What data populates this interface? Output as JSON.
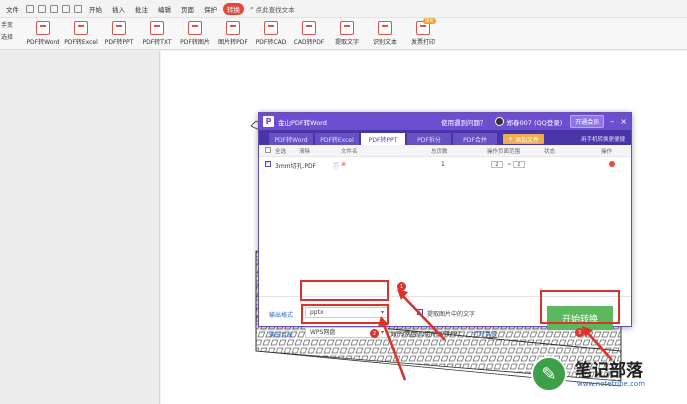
{
  "menubar": {
    "file": "文件",
    "items": [
      "开始",
      "插入",
      "批注",
      "编辑",
      "页面",
      "保护",
      "转换"
    ],
    "search": "点此查找文本"
  },
  "ribbon": {
    "side": [
      "手变",
      "选择"
    ],
    "buttons": [
      "PDF转Word",
      "PDF转Excel",
      "PDF转PPT",
      "PDF转TXT",
      "PDF转图片",
      "图片转PDF",
      "PDF转CAD",
      "CAD转PDF",
      "提取文字",
      "识别文本",
      "发票打印"
    ],
    "badge": "限免"
  },
  "dialog": {
    "title": "金山PDF转Word",
    "help": "使用遇到问题？",
    "user": "郑春007 (QQ登录)",
    "vip": "开通会员",
    "tabs": [
      "PDF转Word",
      "PDF转Excel",
      "PDF转PPT",
      "PDF拆分",
      "PDF合并"
    ],
    "active_tab": "PDF转PPT",
    "add_file": "添加文件",
    "mobile": "用手机转换更便捷",
    "headers": {
      "select_all": "全选",
      "clear": "清除",
      "filename": "文件名",
      "pages": "总页数",
      "range": "操作页面范围",
      "status": "状态",
      "action": "操作"
    },
    "row": {
      "filename": "3mm切孔.PDF",
      "pages": "1",
      "range_from": "1",
      "range_to": "1"
    },
    "output_format_label": "输出格式",
    "output_format_value": "pptx",
    "output_dir_label": "输出目录",
    "output_dir_value": "WPS网盘",
    "extract_text": "提取图片中的文字",
    "path_text": "WPS网盘/应用/PDF转PPT",
    "open_dir": "打开目录",
    "start": "开始转换"
  },
  "markers": [
    "1",
    "2",
    "3"
  ],
  "watermark": {
    "text": "笔记部落",
    "url": "www.notetribe.com"
  },
  "colors": {
    "accent": "#6c4fd0",
    "highlight": "#d9342b",
    "start_button": "#5cb85c"
  }
}
